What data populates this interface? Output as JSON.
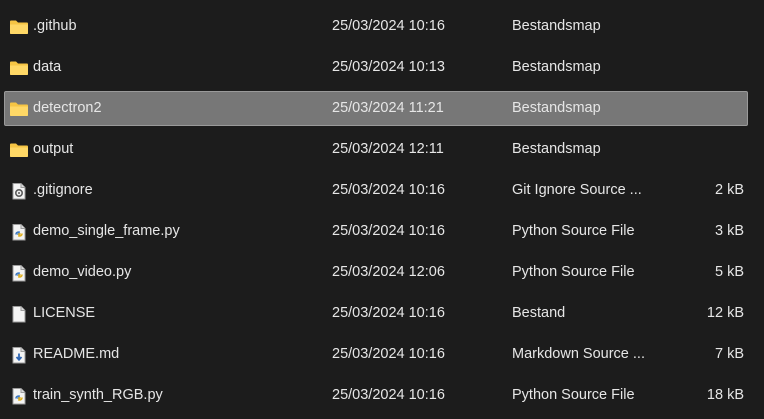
{
  "files": [
    {
      "name": ".github",
      "date": "25/03/2024 10:16",
      "type": "Bestandsmap",
      "size": "",
      "icon": "folder-icon",
      "selected": false
    },
    {
      "name": "data",
      "date": "25/03/2024 10:13",
      "type": "Bestandsmap",
      "size": "",
      "icon": "folder-icon",
      "selected": false
    },
    {
      "name": "detectron2",
      "date": "25/03/2024 11:21",
      "type": "Bestandsmap",
      "size": "",
      "icon": "folder-icon",
      "selected": true
    },
    {
      "name": "output",
      "date": "25/03/2024 12:11",
      "type": "Bestandsmap",
      "size": "",
      "icon": "folder-icon",
      "selected": false
    },
    {
      "name": ".gitignore",
      "date": "25/03/2024 10:16",
      "type": "Git Ignore Source ...",
      "size": "2 kB",
      "icon": "settings-file-icon",
      "selected": false
    },
    {
      "name": "demo_single_frame.py",
      "date": "25/03/2024 10:16",
      "type": "Python Source File",
      "size": "3 kB",
      "icon": "python-file-icon",
      "selected": false
    },
    {
      "name": "demo_video.py",
      "date": "25/03/2024 12:06",
      "type": "Python Source File",
      "size": "5 kB",
      "icon": "python-file-icon",
      "selected": false
    },
    {
      "name": "LICENSE",
      "date": "25/03/2024 10:16",
      "type": "Bestand",
      "size": "12 kB",
      "icon": "blank-file-icon",
      "selected": false
    },
    {
      "name": "README.md",
      "date": "25/03/2024 10:16",
      "type": "Markdown Source ...",
      "size": "7 kB",
      "icon": "markdown-file-icon",
      "selected": false
    },
    {
      "name": "train_synth_RGB.py",
      "date": "25/03/2024 10:16",
      "type": "Python Source File",
      "size": "18 kB",
      "icon": "python-file-icon",
      "selected": false
    }
  ],
  "colors": {
    "background": "#1c1c1c",
    "text": "#e6e6e6",
    "selection": "#777777",
    "folder": "#f6c544"
  }
}
